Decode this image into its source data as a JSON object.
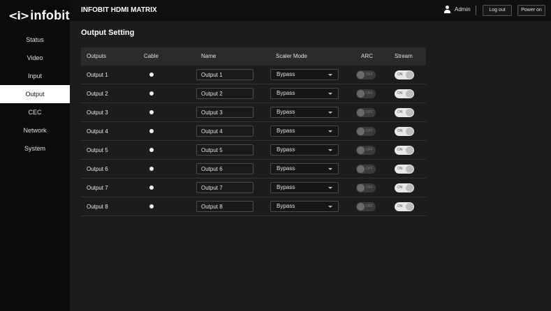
{
  "brand": {
    "mark": "<i>",
    "name": "infobit"
  },
  "sidebar": {
    "items": [
      {
        "label": "Status",
        "active": false
      },
      {
        "label": "Video",
        "active": false
      },
      {
        "label": "Input",
        "active": false
      },
      {
        "label": "Output",
        "active": true
      },
      {
        "label": "CEC",
        "active": false
      },
      {
        "label": "Network",
        "active": false
      },
      {
        "label": "System",
        "active": false
      }
    ]
  },
  "header": {
    "title": "INFOBIT HDMI MATRIX",
    "user": "Admin",
    "logout_label": "Log out",
    "power_label": "Power on"
  },
  "page": {
    "title": "Output Setting"
  },
  "table": {
    "columns": [
      "Outputs",
      "Cable",
      "Name",
      "Scaler Mode",
      "ARC",
      "Stream"
    ],
    "rows": [
      {
        "output": "Output 1",
        "cable": true,
        "name": "Output 1",
        "scaler": "Bypass",
        "arc": "OFF",
        "stream": "ON"
      },
      {
        "output": "Output 2",
        "cable": true,
        "name": "Output 2",
        "scaler": "Bypass",
        "arc": "OFF",
        "stream": "ON"
      },
      {
        "output": "Output 3",
        "cable": true,
        "name": "Output 3",
        "scaler": "Bypass",
        "arc": "OFF",
        "stream": "ON"
      },
      {
        "output": "Output 4",
        "cable": true,
        "name": "Output 4",
        "scaler": "Bypass",
        "arc": "OFF",
        "stream": "ON"
      },
      {
        "output": "Output 5",
        "cable": true,
        "name": "Output 5",
        "scaler": "Bypass",
        "arc": "OFF",
        "stream": "ON"
      },
      {
        "output": "Output 6",
        "cable": true,
        "name": "Output 6",
        "scaler": "Bypass",
        "arc": "OFF",
        "stream": "ON"
      },
      {
        "output": "Output 7",
        "cable": true,
        "name": "Output 7",
        "scaler": "Bypass",
        "arc": "OFF",
        "stream": "ON"
      },
      {
        "output": "Output 8",
        "cable": true,
        "name": "Output 8",
        "scaler": "Bypass",
        "arc": "OFF",
        "stream": "ON"
      }
    ]
  },
  "colors": {
    "sidebar_bg": "#0b0b0b",
    "main_bg": "#1c1c1c",
    "active_nav": "#ffffff",
    "table_header": "#2b2b2b"
  }
}
